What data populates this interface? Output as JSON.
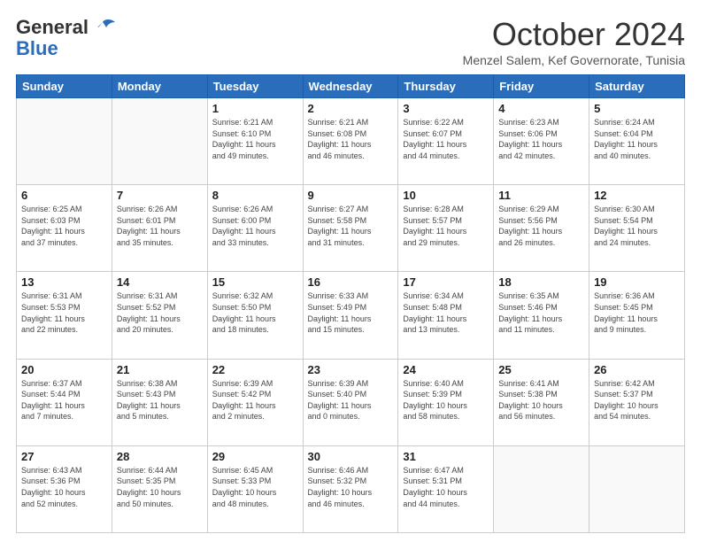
{
  "logo": {
    "general": "General",
    "blue": "Blue"
  },
  "header": {
    "month": "October 2024",
    "subtitle": "Menzel Salem, Kef Governorate, Tunisia"
  },
  "weekdays": [
    "Sunday",
    "Monday",
    "Tuesday",
    "Wednesday",
    "Thursday",
    "Friday",
    "Saturday"
  ],
  "weeks": [
    [
      {
        "day": "",
        "info": ""
      },
      {
        "day": "",
        "info": ""
      },
      {
        "day": "1",
        "info": "Sunrise: 6:21 AM\nSunset: 6:10 PM\nDaylight: 11 hours\nand 49 minutes."
      },
      {
        "day": "2",
        "info": "Sunrise: 6:21 AM\nSunset: 6:08 PM\nDaylight: 11 hours\nand 46 minutes."
      },
      {
        "day": "3",
        "info": "Sunrise: 6:22 AM\nSunset: 6:07 PM\nDaylight: 11 hours\nand 44 minutes."
      },
      {
        "day": "4",
        "info": "Sunrise: 6:23 AM\nSunset: 6:06 PM\nDaylight: 11 hours\nand 42 minutes."
      },
      {
        "day": "5",
        "info": "Sunrise: 6:24 AM\nSunset: 6:04 PM\nDaylight: 11 hours\nand 40 minutes."
      }
    ],
    [
      {
        "day": "6",
        "info": "Sunrise: 6:25 AM\nSunset: 6:03 PM\nDaylight: 11 hours\nand 37 minutes."
      },
      {
        "day": "7",
        "info": "Sunrise: 6:26 AM\nSunset: 6:01 PM\nDaylight: 11 hours\nand 35 minutes."
      },
      {
        "day": "8",
        "info": "Sunrise: 6:26 AM\nSunset: 6:00 PM\nDaylight: 11 hours\nand 33 minutes."
      },
      {
        "day": "9",
        "info": "Sunrise: 6:27 AM\nSunset: 5:58 PM\nDaylight: 11 hours\nand 31 minutes."
      },
      {
        "day": "10",
        "info": "Sunrise: 6:28 AM\nSunset: 5:57 PM\nDaylight: 11 hours\nand 29 minutes."
      },
      {
        "day": "11",
        "info": "Sunrise: 6:29 AM\nSunset: 5:56 PM\nDaylight: 11 hours\nand 26 minutes."
      },
      {
        "day": "12",
        "info": "Sunrise: 6:30 AM\nSunset: 5:54 PM\nDaylight: 11 hours\nand 24 minutes."
      }
    ],
    [
      {
        "day": "13",
        "info": "Sunrise: 6:31 AM\nSunset: 5:53 PM\nDaylight: 11 hours\nand 22 minutes."
      },
      {
        "day": "14",
        "info": "Sunrise: 6:31 AM\nSunset: 5:52 PM\nDaylight: 11 hours\nand 20 minutes."
      },
      {
        "day": "15",
        "info": "Sunrise: 6:32 AM\nSunset: 5:50 PM\nDaylight: 11 hours\nand 18 minutes."
      },
      {
        "day": "16",
        "info": "Sunrise: 6:33 AM\nSunset: 5:49 PM\nDaylight: 11 hours\nand 15 minutes."
      },
      {
        "day": "17",
        "info": "Sunrise: 6:34 AM\nSunset: 5:48 PM\nDaylight: 11 hours\nand 13 minutes."
      },
      {
        "day": "18",
        "info": "Sunrise: 6:35 AM\nSunset: 5:46 PM\nDaylight: 11 hours\nand 11 minutes."
      },
      {
        "day": "19",
        "info": "Sunrise: 6:36 AM\nSunset: 5:45 PM\nDaylight: 11 hours\nand 9 minutes."
      }
    ],
    [
      {
        "day": "20",
        "info": "Sunrise: 6:37 AM\nSunset: 5:44 PM\nDaylight: 11 hours\nand 7 minutes."
      },
      {
        "day": "21",
        "info": "Sunrise: 6:38 AM\nSunset: 5:43 PM\nDaylight: 11 hours\nand 5 minutes."
      },
      {
        "day": "22",
        "info": "Sunrise: 6:39 AM\nSunset: 5:42 PM\nDaylight: 11 hours\nand 2 minutes."
      },
      {
        "day": "23",
        "info": "Sunrise: 6:39 AM\nSunset: 5:40 PM\nDaylight: 11 hours\nand 0 minutes."
      },
      {
        "day": "24",
        "info": "Sunrise: 6:40 AM\nSunset: 5:39 PM\nDaylight: 10 hours\nand 58 minutes."
      },
      {
        "day": "25",
        "info": "Sunrise: 6:41 AM\nSunset: 5:38 PM\nDaylight: 10 hours\nand 56 minutes."
      },
      {
        "day": "26",
        "info": "Sunrise: 6:42 AM\nSunset: 5:37 PM\nDaylight: 10 hours\nand 54 minutes."
      }
    ],
    [
      {
        "day": "27",
        "info": "Sunrise: 6:43 AM\nSunset: 5:36 PM\nDaylight: 10 hours\nand 52 minutes."
      },
      {
        "day": "28",
        "info": "Sunrise: 6:44 AM\nSunset: 5:35 PM\nDaylight: 10 hours\nand 50 minutes."
      },
      {
        "day": "29",
        "info": "Sunrise: 6:45 AM\nSunset: 5:33 PM\nDaylight: 10 hours\nand 48 minutes."
      },
      {
        "day": "30",
        "info": "Sunrise: 6:46 AM\nSunset: 5:32 PM\nDaylight: 10 hours\nand 46 minutes."
      },
      {
        "day": "31",
        "info": "Sunrise: 6:47 AM\nSunset: 5:31 PM\nDaylight: 10 hours\nand 44 minutes."
      },
      {
        "day": "",
        "info": ""
      },
      {
        "day": "",
        "info": ""
      }
    ]
  ]
}
